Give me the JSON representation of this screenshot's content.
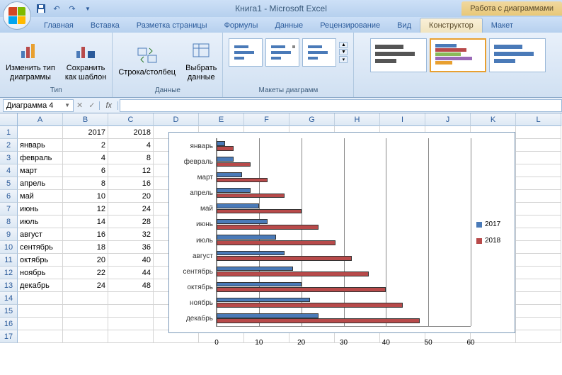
{
  "titlebar": {
    "title": "Книга1 - Microsoft Excel",
    "chart_tools": "Работа с диаграммами"
  },
  "tabs": {
    "home": "Главная",
    "insert": "Вставка",
    "layout": "Разметка страницы",
    "formulas": "Формулы",
    "data": "Данные",
    "review": "Рецензирование",
    "view": "Вид",
    "design": "Конструктор",
    "format": "Макет"
  },
  "ribbon": {
    "change_type": "Изменить тип\nдиаграммы",
    "save_template": "Сохранить\nкак шаблон",
    "group_type": "Тип",
    "switch": "Строка/столбец",
    "select_data": "Выбрать\nданные",
    "group_data": "Данные",
    "group_layouts": "Макеты диаграмм"
  },
  "formula_bar": {
    "name": "Диаграмма 4",
    "fx": "fx"
  },
  "columns": [
    "A",
    "B",
    "C",
    "D",
    "E",
    "F",
    "G",
    "H",
    "I",
    "J",
    "K",
    "L"
  ],
  "sheet": {
    "headers": [
      "",
      "2017",
      "2018"
    ],
    "rows": [
      {
        "label": "январь",
        "a": 2,
        "b": 4
      },
      {
        "label": "февраль",
        "a": 4,
        "b": 8
      },
      {
        "label": "март",
        "a": 6,
        "b": 12
      },
      {
        "label": "апрель",
        "a": 8,
        "b": 16
      },
      {
        "label": "май",
        "a": 10,
        "b": 20
      },
      {
        "label": "июнь",
        "a": 12,
        "b": 24
      },
      {
        "label": "июль",
        "a": 14,
        "b": 28
      },
      {
        "label": "август",
        "a": 16,
        "b": 32
      },
      {
        "label": "сентябрь",
        "a": 18,
        "b": 36
      },
      {
        "label": "октябрь",
        "a": 20,
        "b": 40
      },
      {
        "label": "ноябрь",
        "a": 22,
        "b": 44
      },
      {
        "label": "декабрь",
        "a": 24,
        "b": 48
      }
    ]
  },
  "chart_data": {
    "type": "bar",
    "categories": [
      "январь",
      "февраль",
      "март",
      "апрель",
      "май",
      "июнь",
      "июль",
      "август",
      "сентябрь",
      "октябрь",
      "ноябрь",
      "декабрь"
    ],
    "series": [
      {
        "name": "2017",
        "values": [
          2,
          4,
          6,
          8,
          10,
          12,
          14,
          16,
          18,
          20,
          22,
          24
        ],
        "color": "#4a7ab8"
      },
      {
        "name": "2018",
        "values": [
          4,
          8,
          12,
          16,
          20,
          24,
          28,
          32,
          36,
          40,
          44,
          48
        ],
        "color": "#b84a4a"
      }
    ],
    "x_ticks": [
      0,
      10,
      20,
      30,
      40,
      50,
      60
    ],
    "xlim": [
      0,
      60
    ]
  }
}
